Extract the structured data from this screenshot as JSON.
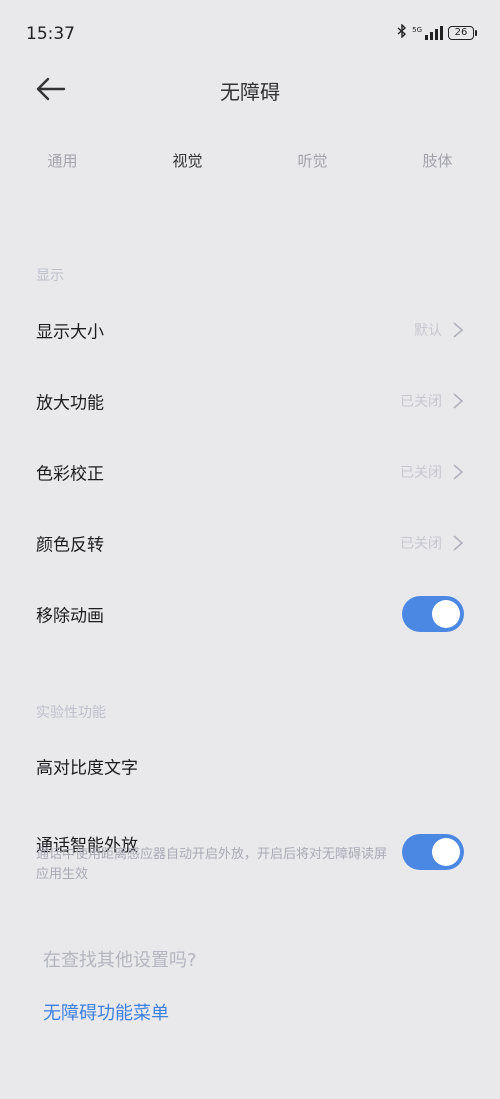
{
  "status_bar": {
    "time": "15:37",
    "network": "5G",
    "battery": "26",
    "bluetooth_icon": "bluetooth-icon",
    "signal_icon": "signal-bars-icon"
  },
  "header": {
    "title": "无障碍",
    "back_icon": "arrow-left-icon"
  },
  "tabs": [
    {
      "label": "通用"
    },
    {
      "label": "视觉"
    },
    {
      "label": "听觉"
    },
    {
      "label": "肢体"
    }
  ],
  "active_tab": "视觉",
  "sections": {
    "display": {
      "label": "显示",
      "items": [
        {
          "label": "显示大小",
          "value": "默认"
        },
        {
          "label": "放大功能",
          "value": "已关闭"
        },
        {
          "label": "色彩校正",
          "value": "已关闭"
        },
        {
          "label": "颜色反转",
          "value": "已关闭"
        },
        {
          "label": "移除动画",
          "toggle": true
        }
      ]
    },
    "experimental": {
      "label": "实验性功能",
      "items": [
        {
          "label": "高对比度文字"
        },
        {
          "label": "通话智能外放",
          "description": "通话中使用距离感应器自动开启外放，开启后将对无障碍读屏应用生效",
          "toggle": true
        }
      ]
    }
  },
  "footer": {
    "hint": "在查找其他设置吗?",
    "link": "无障碍功能菜单"
  },
  "colors": {
    "background": "#e9e9ec",
    "accent": "#4a88e4",
    "link": "#3d82e0"
  }
}
